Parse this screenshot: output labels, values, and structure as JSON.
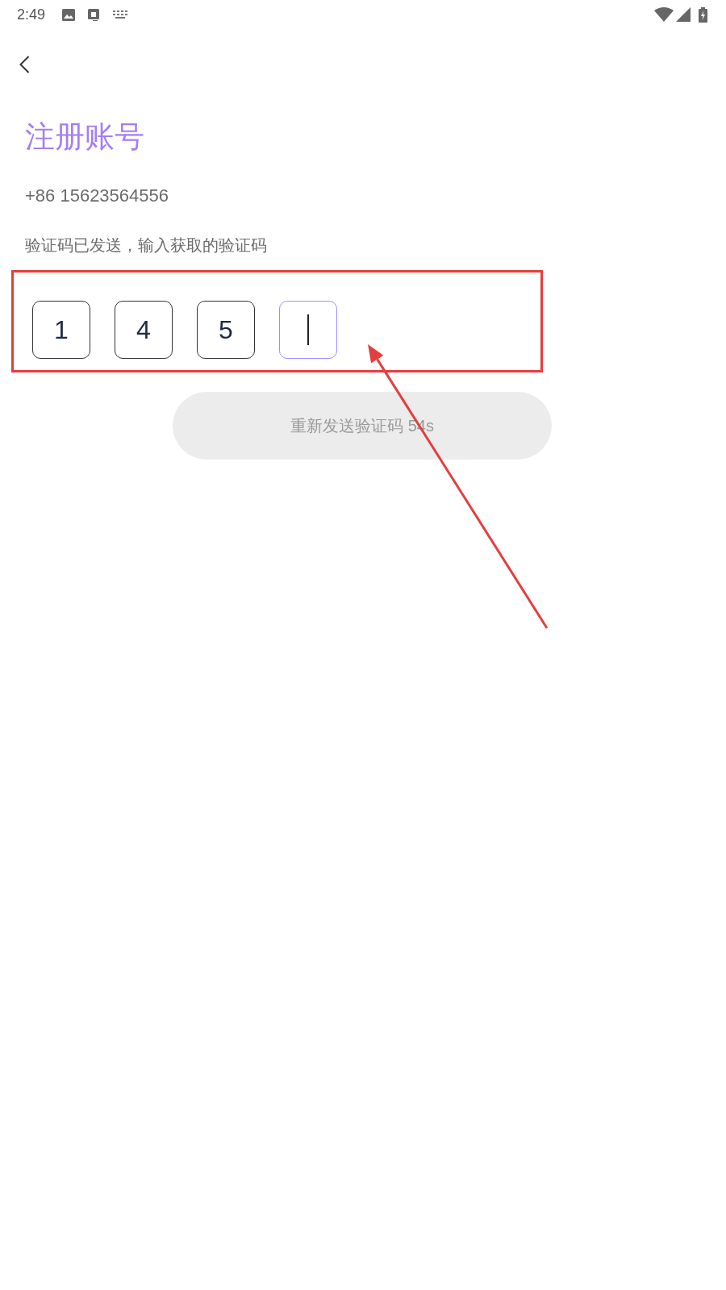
{
  "status_bar": {
    "time": "2:49"
  },
  "header": {
    "title": "注册账号"
  },
  "phone": "+86 15623564556",
  "hint": "验证码已发送，输入获取的验证码",
  "code_boxes": [
    {
      "value": "1",
      "focused": false
    },
    {
      "value": "4",
      "focused": false
    },
    {
      "value": "5",
      "focused": false
    },
    {
      "focused": true
    }
  ],
  "resend_button": {
    "label": "重新发送验证码 54s",
    "disabled": true
  }
}
